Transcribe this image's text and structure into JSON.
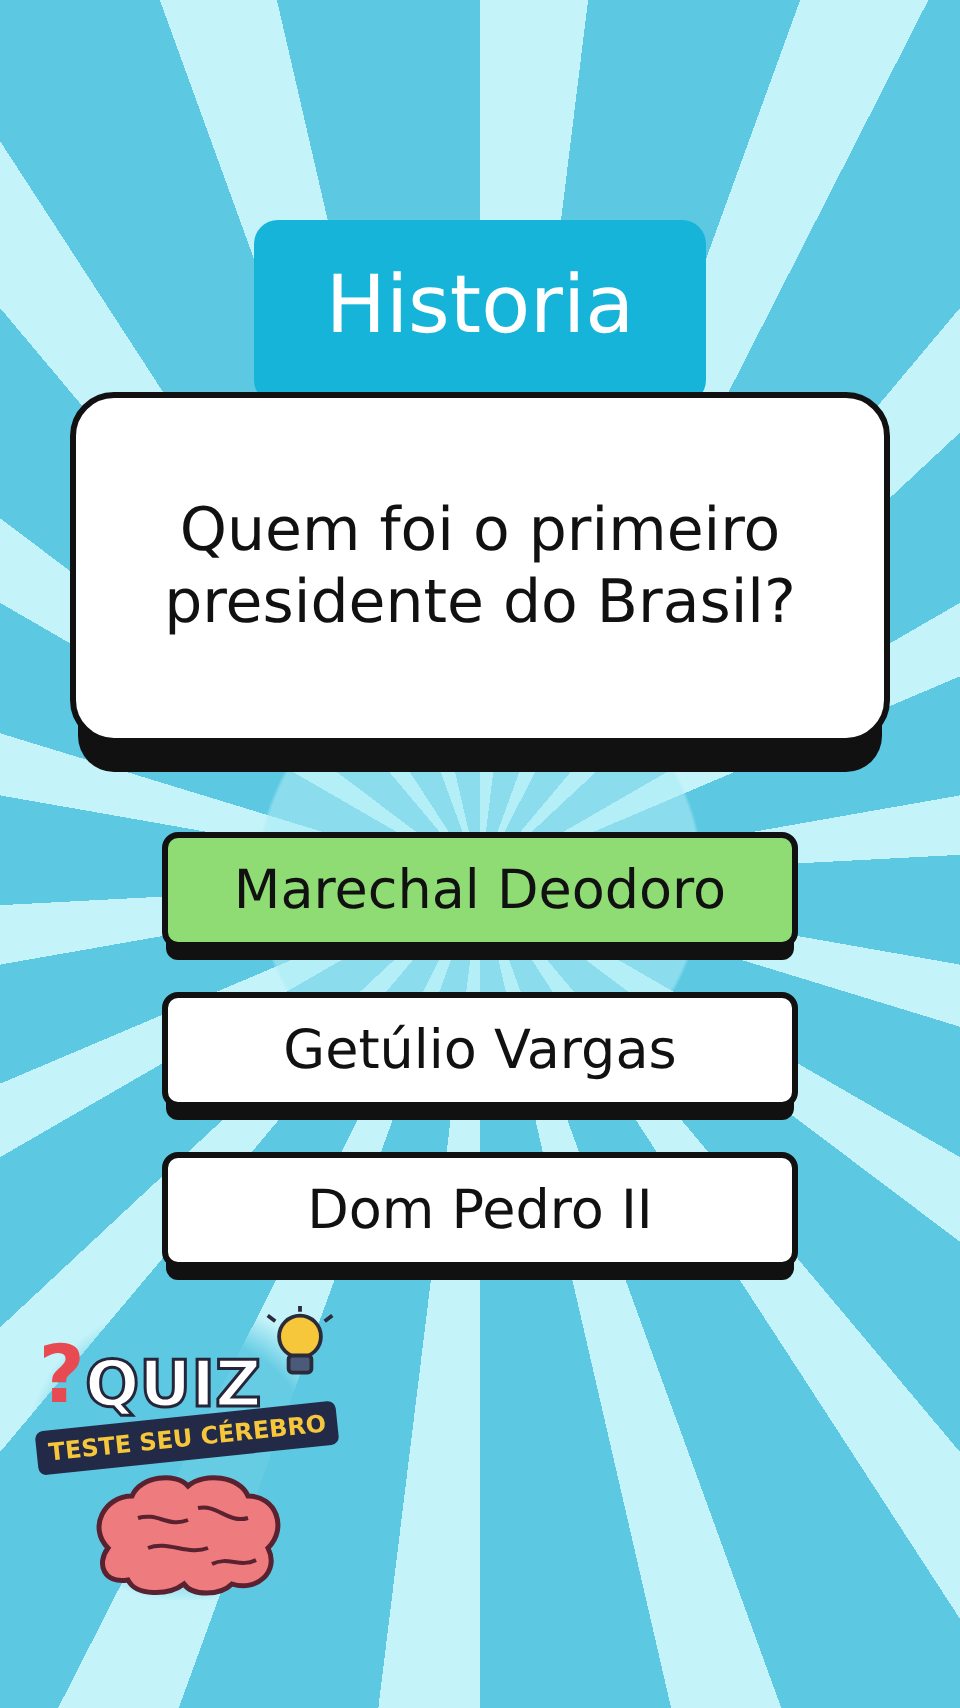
{
  "category": "Historia",
  "question": "Quem foi o primeiro presidente do Brasil?",
  "answers": [
    {
      "label": "Marechal Deodoro",
      "selected": true
    },
    {
      "label": "Getúlio Vargas",
      "selected": false
    },
    {
      "label": "Dom Pedro II",
      "selected": false
    }
  ],
  "logo": {
    "mark": "?",
    "title": "QUIZ",
    "tagline": "TESTE SEU CÉREBRO"
  }
}
